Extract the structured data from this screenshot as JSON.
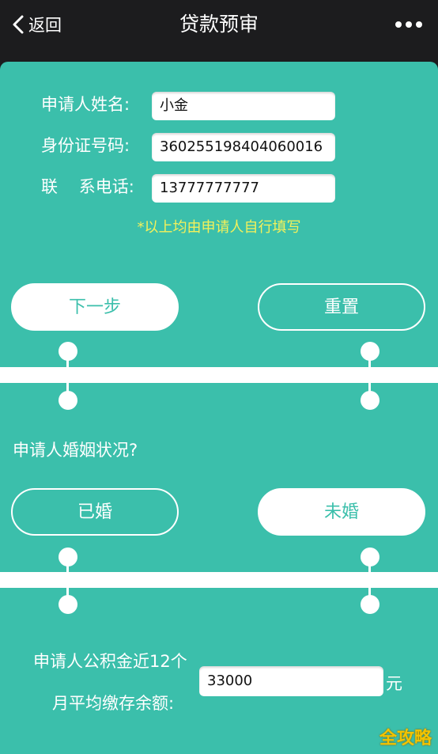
{
  "navbar": {
    "back_label": "返回",
    "title": "贷款预审",
    "more_icon": "more-dots-icon"
  },
  "form": {
    "name_label": "申请人姓名:",
    "name_value": "小金",
    "id_label": "身份证号码:",
    "id_value": "360255198404060016",
    "phone_label": "联    系电话:",
    "phone_value": "13777777777",
    "hint": "*以上均由申请人自行填写"
  },
  "actions": {
    "next_label": "下一步",
    "reset_label": "重置"
  },
  "marital": {
    "question": "申请人婚姻状况?",
    "married_label": "已婚",
    "unmarried_label": "未婚"
  },
  "fund": {
    "label_line1": "申请人公积金近12个",
    "label_line2": "月平均缴存余额:",
    "value": "33000",
    "unit": "元"
  },
  "watermark": "全攻略",
  "colors": {
    "panel": "#3bbfab",
    "navbar": "#1c1c1e",
    "hint": "#f4f15a"
  }
}
